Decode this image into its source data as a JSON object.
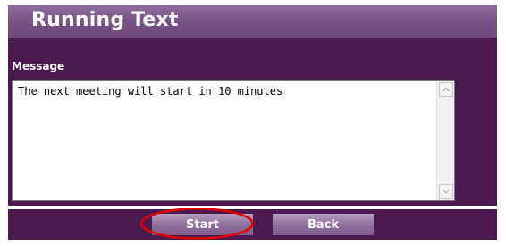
{
  "header": {
    "title": "Running Text"
  },
  "message": {
    "label": "Message",
    "value": "The next meeting will start in 10 minutes"
  },
  "actions": {
    "start_label": "Start",
    "back_label": "Back"
  },
  "icons": {
    "scroll_up": "chevron-up-icon",
    "scroll_down": "chevron-down-icon"
  },
  "colors": {
    "panel": "#4b1b4f",
    "title_bar": "#765184",
    "button": "#93749e",
    "highlight_ring": "#e00000"
  }
}
